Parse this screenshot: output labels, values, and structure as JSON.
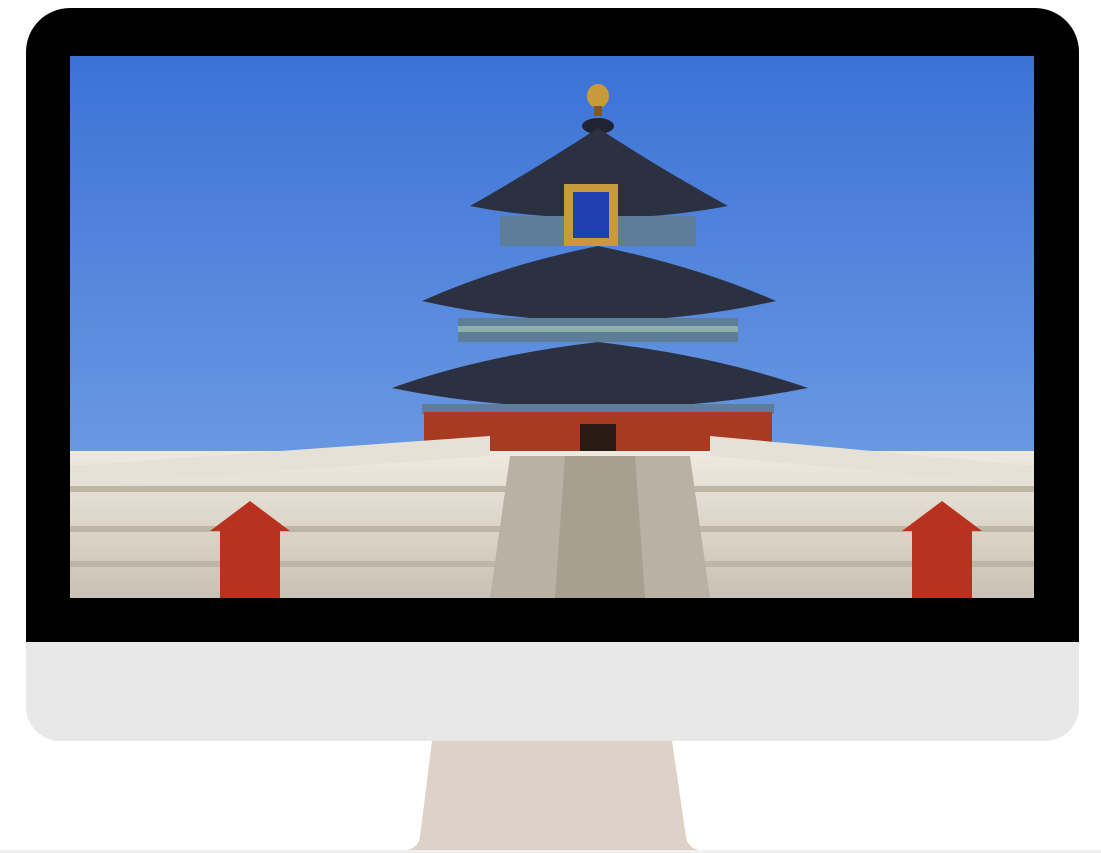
{
  "monitor": {
    "bezel_color": "#000000",
    "chin_color": "#e8e8e8",
    "stand_color": "#dcd2c8"
  },
  "screen": {
    "wallpaper": {
      "subject": "temple-of-heaven",
      "sky_color": "#3b74d8",
      "roof_color": "#2b3140",
      "wall_color": "#a83a22",
      "stone_color": "#e6e1d6"
    }
  }
}
